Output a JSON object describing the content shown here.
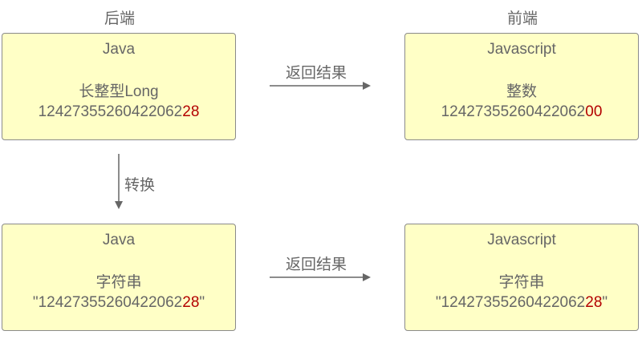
{
  "headers": {
    "backend": "后端",
    "frontend": "前端"
  },
  "boxes": {
    "top_left": {
      "title": "Java",
      "type": "长整型Long",
      "num_main": "12427355260422062",
      "num_tail": "28",
      "q": ""
    },
    "top_right": {
      "title": "Javascript",
      "type": "整数",
      "num_main": "12427355260422062",
      "num_tail": "00",
      "q": ""
    },
    "bottom_left": {
      "title": "Java",
      "type": "字符串",
      "num_main": "12427355260422062",
      "num_tail": "28",
      "q": "\""
    },
    "bottom_right": {
      "title": "Javascript",
      "type": "字符串",
      "num_main": "12427355260422062",
      "num_tail": "28",
      "q": "\""
    }
  },
  "arrows": {
    "return_top": "返回结果",
    "convert": "转换",
    "return_bottom": "返回结果"
  },
  "colors": {
    "box_fill": "#ffffc6",
    "highlight": "#b30000",
    "text": "#666666"
  }
}
